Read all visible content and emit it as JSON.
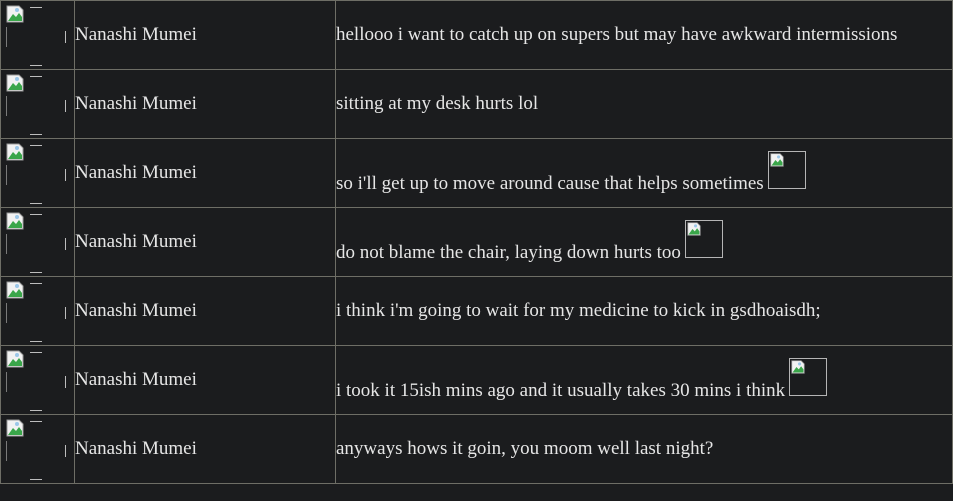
{
  "messages": [
    {
      "author": "Nanashi Mumei",
      "text": "hellooo i want to catch up on supers but may have awkward intermissions",
      "emote": false
    },
    {
      "author": "Nanashi Mumei",
      "text": "sitting at my desk hurts lol",
      "emote": false
    },
    {
      "author": "Nanashi Mumei",
      "text": "so i'll get up to move around cause that helps sometimes",
      "emote": true
    },
    {
      "author": "Nanashi Mumei",
      "text": "do not blame the chair, laying down hurts too",
      "emote": true
    },
    {
      "author": "Nanashi Mumei",
      "text": "i think i'm going to wait for my medicine to kick in gsdhoaisdh;",
      "emote": false
    },
    {
      "author": "Nanashi Mumei",
      "text": "i took it 15ish mins ago and it usually takes 30 mins i think",
      "emote": true
    },
    {
      "author": "Nanashi Mumei",
      "text": "anyways hows it goin, you moom well last night?",
      "emote": false
    }
  ],
  "icons": {
    "avatar": "broken-image-icon",
    "emote": "broken-image-icon"
  },
  "colors": {
    "background": "#1b1c1e",
    "border": "#6e6e66",
    "text": "#e6e6e6"
  }
}
